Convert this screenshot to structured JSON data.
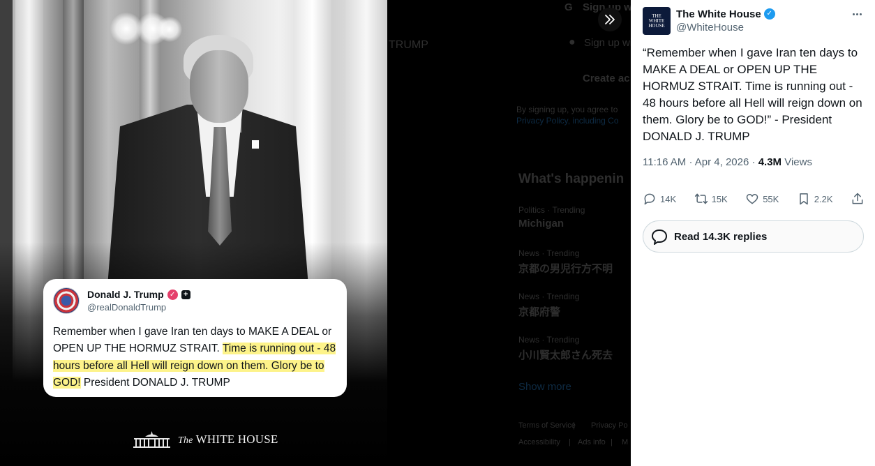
{
  "image": {
    "embedded_post": {
      "display_name": "Donald J. Trump",
      "handle": "@realDonaldTrump",
      "text_plain": "Remember when I gave Iran ten days to MAKE A DEAL or OPEN UP THE HORMUZ STRAIT. ",
      "text_highlight": "Time is running out - 48 hours before all Hell will reign down on them. Glory be to GOD!",
      "text_tail": " President DONALD J. TRUMP",
      "highlight_color": "#fdf38a"
    },
    "watermark_prefix": "The",
    "watermark": "WHITE HOUSE"
  },
  "background_page": {
    "signup_google": "Sign up wi",
    "signup_apple": "Sign up wi",
    "header_fragment": "TRUMP",
    "create_account": "Create ac",
    "terms_line1": "By signing up, you agree to",
    "terms_line2": "Privacy Policy, including Co",
    "whats_happening": "What's happenin",
    "trends": [
      {
        "context": "Politics · Trending",
        "topic": "Michigan"
      },
      {
        "context": "News · Trending",
        "topic": "京都の男児行方不明"
      },
      {
        "context": "News · Trending",
        "topic": "京都府警"
      },
      {
        "context": "News · Trending",
        "topic": "小川賢太郎さん死去"
      }
    ],
    "show_more": "Show more",
    "footer_links_1": [
      "Terms of Service",
      "Privacy Po"
    ],
    "footer_links_2": [
      "Accessibility",
      "Ads info",
      "M"
    ]
  },
  "tweet": {
    "author_name": "The White House",
    "author_handle": "@WhiteHouse",
    "avatar_text_1": "THE",
    "avatar_text_2": "WHITE",
    "avatar_text_3": "HOUSE",
    "text": "“Remember when I gave Iran ten days to MAKE A DEAL or OPEN UP THE HORMUZ STRAIT. Time is running out - 48 hours before all Hell will reign down on them. Glory be to GOD!” - President DONALD J. TRUMP",
    "time": "11:16 AM",
    "date": "Apr 4, 2026",
    "views_count": "4.3M",
    "views_label": "Views",
    "replies": "14K",
    "reposts": "15K",
    "likes": "55K",
    "bookmarks": "2.2K",
    "read_replies": "Read 14.3K replies",
    "colors": {
      "verified": "#1d9bf0",
      "text": "#0f1419",
      "secondary": "#536471"
    }
  },
  "icons": [
    "chevrons-right-icon",
    "verified-badge-icon",
    "more-icon",
    "reply-icon",
    "repost-icon",
    "like-icon",
    "bookmark-icon",
    "share-icon",
    "speech-bubble-icon",
    "google-icon",
    "apple-icon"
  ]
}
